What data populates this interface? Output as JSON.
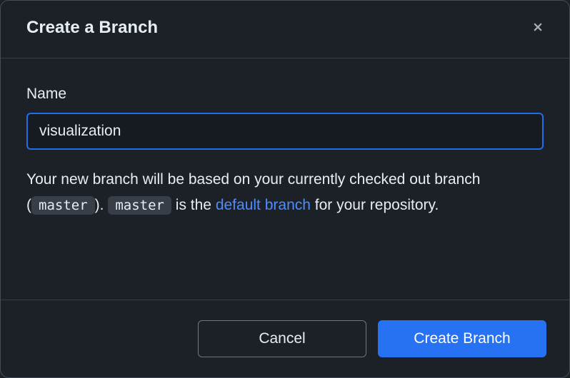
{
  "dialog": {
    "title": "Create a Branch",
    "field_label": "Name",
    "input_value": "visualization",
    "help": {
      "prefix": "Your new branch will be based on your currently checked out branch (",
      "chip1": "master",
      "mid1": "). ",
      "chip2": "master",
      "mid2": " is the ",
      "link_text": "default branch",
      "suffix": " for your repository."
    },
    "buttons": {
      "cancel": "Cancel",
      "submit": "Create Branch"
    }
  }
}
